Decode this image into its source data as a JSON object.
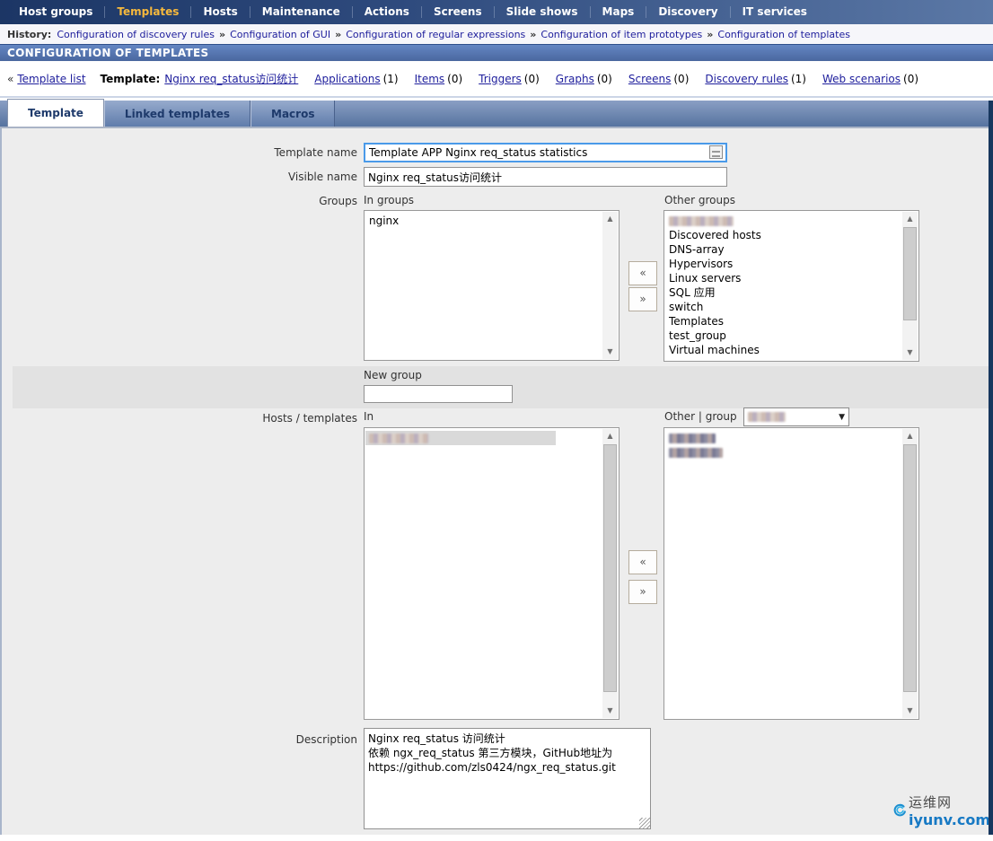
{
  "colors": {
    "nav_bg_left": "#1c3665",
    "nav_bg_right": "#5b78a6",
    "nav_active_text": "#f7b93c",
    "header_bar": "#4a679f",
    "link": "#20209d",
    "tab_text": "#1e3a6b",
    "content_bg": "#ededed",
    "right_edge_bar": "#17375e",
    "band": "#e2e2e2",
    "focus_border": "#4a9ae9"
  },
  "nav": {
    "items": [
      {
        "label": "Host groups",
        "active": false
      },
      {
        "label": "Templates",
        "active": true
      },
      {
        "label": "Hosts",
        "active": false
      },
      {
        "label": "Maintenance",
        "active": false
      },
      {
        "label": "Actions",
        "active": false
      },
      {
        "label": "Screens",
        "active": false
      },
      {
        "label": "Slide shows",
        "active": false
      },
      {
        "label": "Maps",
        "active": false
      },
      {
        "label": "Discovery",
        "active": false
      },
      {
        "label": "IT services",
        "active": false
      }
    ]
  },
  "history": {
    "label": "History:",
    "separator": "»",
    "links": [
      "Configuration of discovery rules",
      "Configuration of GUI",
      "Configuration of regular expressions",
      "Configuration of item prototypes",
      "Configuration of templates"
    ]
  },
  "header": {
    "title": "CONFIGURATION OF TEMPLATES"
  },
  "subnav": {
    "back_arrow": "«",
    "back_link": "Template list",
    "template_label": "Template:",
    "template_name": "Nginx req_status访问统计",
    "links": [
      {
        "label": "Applications",
        "count": "(1)"
      },
      {
        "label": "Items",
        "count": "(0)"
      },
      {
        "label": "Triggers",
        "count": "(0)"
      },
      {
        "label": "Graphs",
        "count": "(0)"
      },
      {
        "label": "Screens",
        "count": "(0)"
      },
      {
        "label": "Discovery rules",
        "count": "(1)"
      },
      {
        "label": "Web scenarios",
        "count": "(0)"
      }
    ]
  },
  "tabs": [
    {
      "label": "Template",
      "active": true
    },
    {
      "label": "Linked templates",
      "active": false
    },
    {
      "label": "Macros",
      "active": false
    }
  ],
  "form": {
    "template_name": {
      "label": "Template name",
      "value": "Template APP Nginx req_status statistics"
    },
    "visible_name": {
      "label": "Visible name",
      "value": "Nginx req_status访问统计"
    },
    "groups": {
      "label": "Groups",
      "in_caption": "In groups",
      "in_items": [
        "nginx"
      ],
      "other_caption": "Other groups",
      "other_items": [
        {
          "redacted": true
        },
        {
          "label": "Discovered hosts"
        },
        {
          "label": "DNS-array"
        },
        {
          "label": "Hypervisors"
        },
        {
          "label": "Linux servers"
        },
        {
          "label": "SQL 应用"
        },
        {
          "label": "switch"
        },
        {
          "label": "Templates"
        },
        {
          "label": "test_group"
        },
        {
          "label": "Virtual machines"
        }
      ],
      "move_left": "«",
      "move_right": "»"
    },
    "new_group": {
      "label": "New group",
      "value": ""
    },
    "hosts": {
      "label": "Hosts / templates",
      "in_caption": "In",
      "in_items": [
        {
          "redacted": true
        }
      ],
      "other_caption": "Other | group",
      "other_items": [
        {
          "redacted": true
        },
        {
          "redacted": true
        }
      ],
      "move_left": "«",
      "move_right": "»"
    },
    "description": {
      "label": "Description",
      "value": "Nginx req_status 访问统计\n依赖 ngx_req_status 第三方模块，GitHub地址为\nhttps://github.com/zls0424/ngx_req_status.git"
    }
  },
  "watermark": {
    "line1": "运维网",
    "line2": "iyunv.com"
  }
}
